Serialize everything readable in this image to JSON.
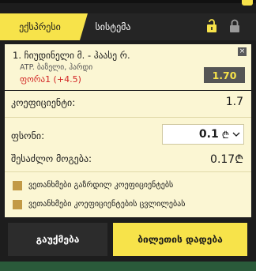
{
  "tabs": {
    "express": "ექსპრესი",
    "system": "სისტემა"
  },
  "icons": {
    "lock_open": "unlock-icon",
    "lock_closed": "lock-icon",
    "remove": "close-icon",
    "dropdown": "chevron-down-icon"
  },
  "bet": {
    "index_title": "1. ჩიუდინელი მ. - ჰაასე რ.",
    "league": "ATP. ბაზელი, ჰარდი",
    "market": "ფორა1 (+4.5)",
    "remove_label": "×",
    "odds": "1.70"
  },
  "totals": {
    "coef_label": "კოეფიციენტი:",
    "coef_value": "1.7",
    "stake_label": "ფსონი:",
    "stake_value": "0.1",
    "currency": "₾",
    "payout_label": "შესაძლო მოგება:",
    "payout_value": "0.17₾"
  },
  "options": {
    "accept_higher": "ვეთანხმები გაზრდილ კოეფიციენტებს",
    "accept_changes": "ვეთანხმები კოეფიციენტების ცვლილებას"
  },
  "buttons": {
    "cancel": "გაუქმება",
    "place": "ბილეთის დადება"
  },
  "colors": {
    "accent": "#f7e34a",
    "panel": "#fbf6d3",
    "dark": "#1d1d1d",
    "market_red": "#d22222",
    "checkbox": "#c29a46"
  }
}
